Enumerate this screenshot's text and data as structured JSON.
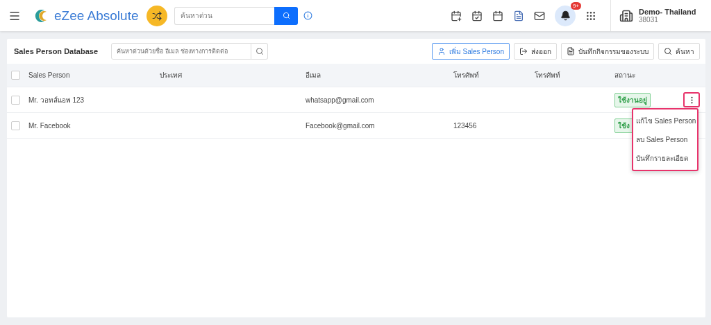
{
  "topbar": {
    "brand": "eZee Absolute",
    "search": {
      "placeholder": "ค้นหาด่วน"
    },
    "notification_badge": "9+",
    "property": {
      "name": "Demo- Thailand",
      "code": "38031"
    }
  },
  "panel": {
    "title": "Sales Person Database",
    "search": {
      "placeholder": "ค้นหาด่วนด้วยชื่อ อีเมล ช่องทางการติดต่อ"
    },
    "buttons": [
      {
        "label": "เพิ่ม Sales Person",
        "kind": "primary"
      },
      {
        "label": "ส่งออก",
        "kind": "export"
      },
      {
        "label": "บันทึกกิจกรรมของระบบ",
        "kind": "log"
      },
      {
        "label": "ค้นหา",
        "kind": "search"
      }
    ]
  },
  "table": {
    "select_all_checked": false,
    "columns": [
      "Sales Person",
      "ประเทศ",
      "อีเมล",
      "โทรศัพท์",
      "โทรศัพท์",
      "สถานะ"
    ],
    "rows": [
      {
        "checked": false,
        "name": "Mr. วอทส์แอพ 123",
        "email": "whatsapp@gmail.com",
        "phone": "",
        "status": "ใช้งานอยู่",
        "menu_open": true
      },
      {
        "checked": false,
        "name": "Mr. Facebook",
        "email": "Facebook@gmail.com",
        "phone": "123456",
        "status": "ใช้ง",
        "menu_open": false
      }
    ]
  },
  "row_menu": {
    "items": [
      "แก้ไข Sales Person",
      "ลบ Sales Person",
      "บันทึกรายละเอียด"
    ]
  }
}
